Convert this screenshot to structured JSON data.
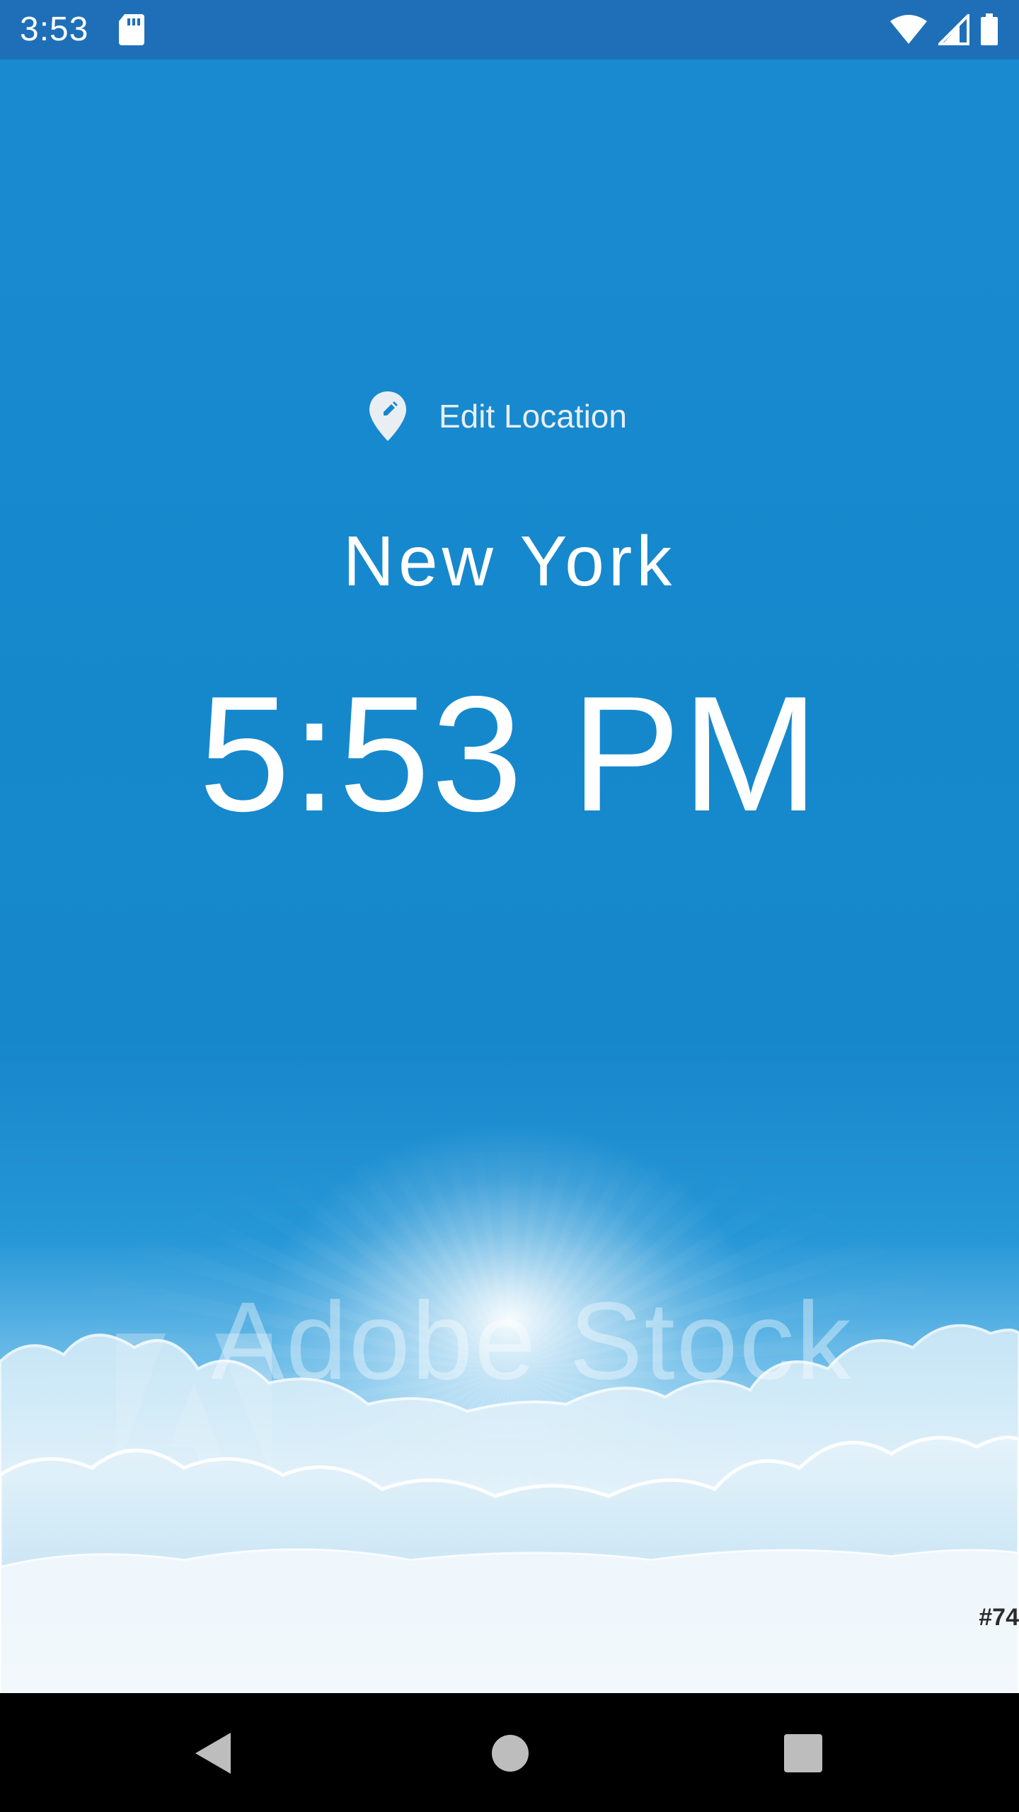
{
  "status_bar": {
    "time": "3:53",
    "icons": [
      "sd-card-icon",
      "wifi-icon",
      "cell-signal-icon",
      "battery-icon"
    ]
  },
  "location": {
    "edit_label": "Edit Location",
    "icon": "edit-location-icon",
    "city": "New York",
    "time": "5:53 PM"
  },
  "background": {
    "watermark_text": "Adobe Stock",
    "corner_id": "#74"
  },
  "nav_bar": {
    "icons": [
      "back-icon",
      "home-icon",
      "recents-icon"
    ]
  },
  "colors": {
    "status_bar": "#1e6fb8",
    "sky": "#1588cc",
    "text": "#ffffff",
    "edit_label": "#e9eef2",
    "nav_bar": "#000000"
  }
}
